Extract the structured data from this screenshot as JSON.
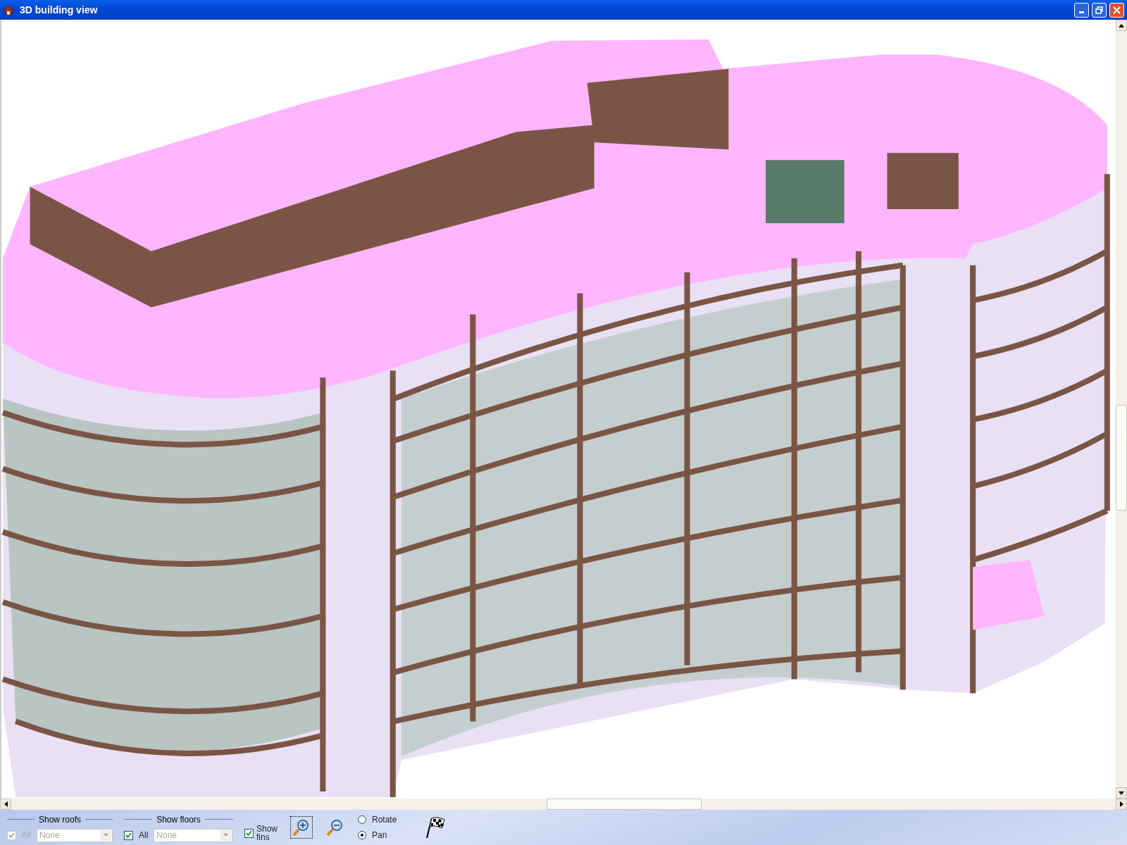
{
  "window": {
    "title": "3D building view"
  },
  "toolbar": {
    "roofs": {
      "label": "Show roofs",
      "all": {
        "label": "All",
        "checked": true,
        "disabled": true
      },
      "dropdown": {
        "value": "None",
        "disabled": true
      }
    },
    "floors": {
      "label": "Show floors",
      "all": {
        "label": "All",
        "checked": true,
        "disabled": false
      },
      "dropdown": {
        "value": "None",
        "disabled": true
      }
    },
    "fins": {
      "label": "Show fins",
      "checked": true
    },
    "tools": [
      {
        "kind": "zoom-in",
        "selected": true
      },
      {
        "kind": "zoom-out",
        "selected": false
      }
    ],
    "modes": [
      {
        "label": "Rotate",
        "selected": false
      },
      {
        "label": "Pan",
        "selected": true
      }
    ]
  }
}
